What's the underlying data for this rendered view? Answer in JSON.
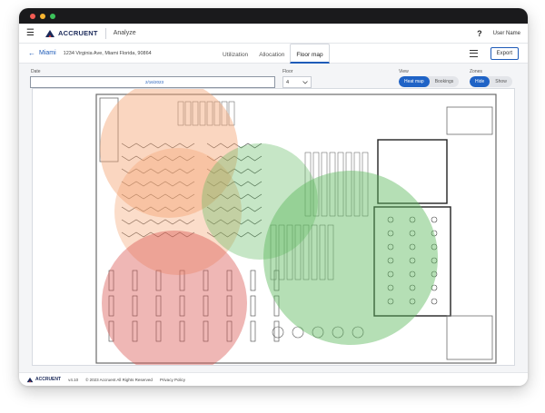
{
  "window": {
    "dots": [
      "#f25c54",
      "#f7b531",
      "#3cc25b"
    ]
  },
  "appbar": {
    "menu_icon": "hamburger-menu-icon",
    "brand": "ACCRUENT",
    "app_name": "Analyze",
    "help_icon": "help-icon",
    "user_name": "User Name"
  },
  "subbar": {
    "back_icon": "arrow-left-icon",
    "site_name": "Miami",
    "site_address": "1234 Virginia Ave, Miami Florida, 90864",
    "tabs": [
      {
        "label": "Utilization",
        "active": false
      },
      {
        "label": "Allocation",
        "active": false
      },
      {
        "label": "Floor map",
        "active": true
      }
    ],
    "list_icon": "list-view-icon",
    "export_label": "Export"
  },
  "filters": {
    "date_label": "Date",
    "date_value": "2/16/2023",
    "floor_label": "Floor",
    "floor_value": "4",
    "view_label": "View",
    "view_options": [
      "Heat map",
      "Bookings"
    ],
    "view_selected": "Heat map",
    "zones_label": "Zones",
    "zones_options": [
      "Hide",
      "Show"
    ],
    "zones_selected": "Hide"
  },
  "heatmap_colors": {
    "orange": "#f4a574",
    "red": "#d9534f",
    "green": "#5cb85c"
  },
  "footer": {
    "brand": "ACCRUENT",
    "version": "v4.10",
    "copyright": "© 2023 Accruent All Rights Reserved",
    "privacy": "Privacy Policy"
  }
}
